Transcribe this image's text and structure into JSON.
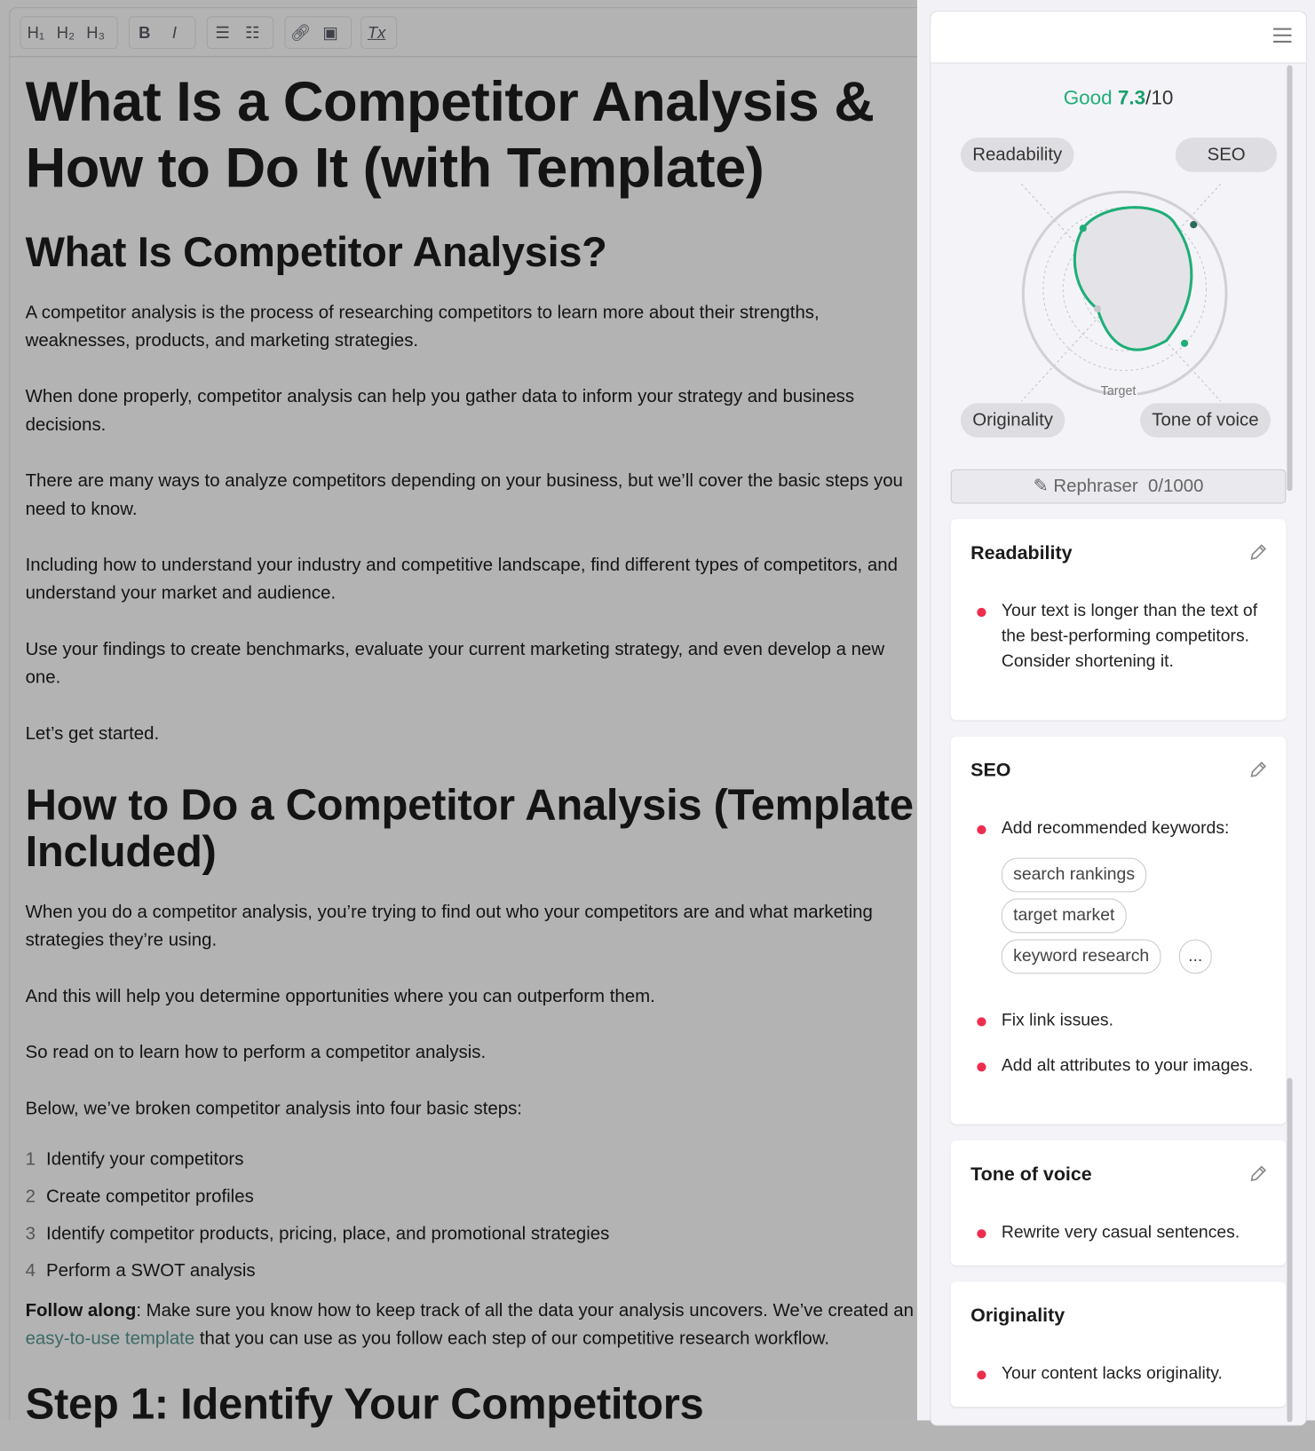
{
  "toolbar": {
    "groups": [
      [
        "H1",
        "H2",
        "H3"
      ],
      [
        "B",
        "I"
      ],
      [
        "numbered-list",
        "bulleted-list"
      ],
      [
        "link",
        "image"
      ],
      [
        "clear-format"
      ]
    ],
    "labels": {
      "h1": "H₁",
      "h2": "H₂",
      "h3": "H₃",
      "bold": "B",
      "italic": "I",
      "clear": "Tx"
    }
  },
  "article": {
    "title": "What Is a Competitor Analysis & How to Do It (with Template)",
    "h2_1": "What Is Competitor Analysis?",
    "p1": "A competitor analysis is the process of researching competitors to learn more about their strengths, weaknesses, products, and marketing strategies.",
    "p2": "When done properly, competitor analysis can help you gather data to inform your strategy and business decisions.",
    "p3": "There are many ways to analyze competitors depending on your business, but we’ll cover the basic steps you need to know.",
    "p4": "Including how to understand your industry and competitive landscape, find different types of competitors, and understand your market and audience.",
    "p5": "Use your findings to create benchmarks, evaluate your current marketing strategy, and even develop a new one.",
    "p6": "Let’s get started.",
    "h2_2": "How to Do a Competitor Analysis (Template Included)",
    "p7": "When you do a competitor analysis, you’re trying to find out who your competitors are and what marketing strategies they’re using.",
    "p8": "And this will help you determine opportunities where you can outperform them.",
    "p9": "So read on to learn how to perform a competitor analysis.",
    "p10": "Below, we’ve broken competitor analysis into four basic steps:",
    "steps": [
      {
        "n": "1",
        "t": "Identify your competitors"
      },
      {
        "n": "2",
        "t": "Create competitor profiles"
      },
      {
        "n": "3",
        "t": "Identify competitor products, pricing, place, and promotional strategies"
      },
      {
        "n": "4",
        "t": "Perform a SWOT analysis"
      }
    ],
    "follow": {
      "bold": "Follow along",
      "a": ": Make sure you know how to keep track of all the data your analysis uncovers. We’ve created an ",
      "link": "easy-to-use template",
      "b": " that you can use as you follow each step of our competitive research workflow."
    },
    "h2_3": "Step 1: Identify Your Competitors"
  },
  "panel": {
    "score": {
      "label": "Good",
      "value": "7.3",
      "max": "/10"
    },
    "axes": {
      "readability": "Readability",
      "seo": "SEO",
      "originality": "Originality",
      "tone": "Tone of voice",
      "target": "Target"
    },
    "rephraser": {
      "label": "Rephraser",
      "count": "0/1000"
    },
    "cards": {
      "readability": {
        "title": "Readability",
        "items": [
          "Your text is longer than the text of the best-performing competitors. Consider shortening it."
        ]
      },
      "seo": {
        "title": "SEO",
        "items": [
          "Add recommended keywords:",
          "Fix link issues.",
          "Add alt attributes to your images."
        ],
        "keywords": [
          "search rankings",
          "target market",
          "keyword research",
          "..."
        ]
      },
      "tone": {
        "title": "Tone of voice",
        "items": [
          "Rewrite very casual sentences."
        ]
      },
      "originality": {
        "title": "Originality",
        "items": [
          "Your content lacks originality."
        ]
      }
    }
  },
  "colors": {
    "accent": "#1fae78",
    "issue": "#ee2d4e",
    "link": "#3c6a66"
  }
}
